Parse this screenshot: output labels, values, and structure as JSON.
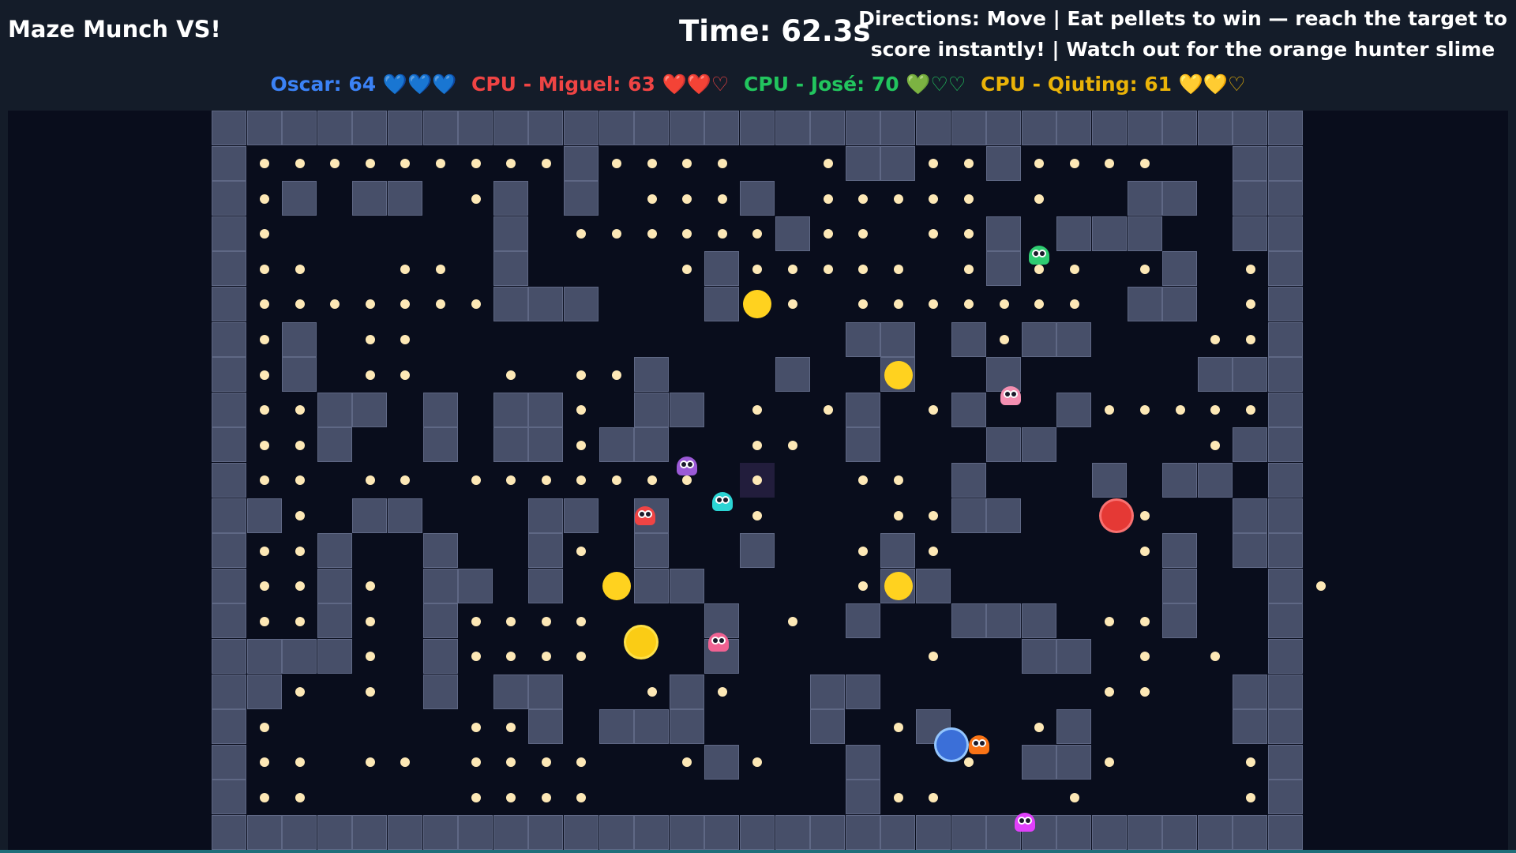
{
  "header": {
    "title": "Maze Munch VS!",
    "timer": "Time: 62.3s",
    "directions_line1": "Directions: Move | Eat pellets to win — reach the target to",
    "directions_line2": "score instantly! | Watch out for the orange hunter slime"
  },
  "scoreboard": [
    {
      "label": "Oscar: 64",
      "hearts": "💙💙💙",
      "color": "#3b82f6"
    },
    {
      "label": "CPU - Miguel: 63",
      "hearts": "❤️❤️♡",
      "color": "#ef4444"
    },
    {
      "label": "CPU - José: 70",
      "hearts": "💚♡♡",
      "color": "#22c55e"
    },
    {
      "label": "CPU - Qiuting: 61",
      "hearts": "💛💛♡",
      "color": "#eab308"
    }
  ],
  "maze": {
    "cols": 31,
    "rows": 21,
    "rows_map": [
      "###############################",
      "#.........#.......##..#......##",
      "#.#.##..#.#....#..........##.##",
      "#.......#.......#.....#.###..##",
      "#.......#.....#.......#....#..#",
      "#.......###...#...........##..#",
      "#.#...............##.#.##.....#",
      "#.#.........#...#..#..#.....###",
      "#..##.#.##..##....#..#..#.....#",
      "#..#..#.##.##.....#...##.....##",
      "#....................#...#.##.#",
      "##..##...##.#........##......##",
      "#..#..#..#..#..#...#.......#.##",
      "#..#..##.#..##.....##......#..#",
      "#..#..#.......#...#..###...#..#",
      "####..#.......#........##.....#",
      "##....#.##...#...##..........##",
      "#........#.###...#..#...#....##",
      "#.............#...#....##.....#",
      "#.................#...........#",
      "###############################"
    ],
    "pellet_rows": [
      "...............................",
      ".ooooooooo.oooo..oo.ooooooo....",
      ".o.....oo.o.oooo.ooooo.o..oo.o.",
      ".o........oooooo.oo.ooo.......",
      ".oo..oo......ooooooo.oooo.o..oo",
      ".ooooooo.......oo.ooooooo....o.",
      ".o..oo............oo.oo.....ooo",
      ".o..oo..o.ooo...o.....o.....oo.",
      ".oo.....ooo.o..o.oo.oo...oooooo",
      ".oo......ooo...oo...........ooo",
      ".oo.oo.ooooooo.o..oo........o.o",
      "..o.......o.o..o...oo.....o..o.",
      ".oo.......o....o..ooo.....o..o.",
      ".oo.o..o.o..o.....o...........oo",
      ".oo.o..oooo.....o.o......oo...",
      "....o..oooo.........o.....o.o.o",
      "..o.o.o.o...o.o..........oo..o.",
      ".o.....ooo.........o...o.......",
      ".oo.oo.oooo..ooo.....o...o...oo",
      ".oo....oooo........oo...o....oo",
      "..............................."
    ],
    "power_pellets": [
      {
        "c": 15,
        "r": 5
      },
      {
        "c": 19,
        "r": 7
      },
      {
        "c": 11,
        "r": 13
      },
      {
        "c": 19,
        "r": 13
      }
    ],
    "target_tile": {
      "c": 15,
      "r": 10
    }
  },
  "slimes": [
    {
      "name": "green-slime",
      "color": "#2ecc71",
      "c": 23.5,
      "r": 4.1
    },
    {
      "name": "pink-slime",
      "color": "#f48fb1",
      "c": 22.7,
      "r": 8.1
    },
    {
      "name": "purple-slime",
      "color": "#9b59d6",
      "c": 13.5,
      "r": 10.1
    },
    {
      "name": "cyan-slime",
      "color": "#2bd4d4",
      "c": 14.5,
      "r": 11.1
    },
    {
      "name": "red-slime",
      "color": "#ef4444",
      "c": 12.3,
      "r": 11.5
    },
    {
      "name": "pink-slime",
      "color": "#f06292",
      "c": 14.4,
      "r": 15.1
    },
    {
      "name": "orange-hunter-slime",
      "color": "#f97316",
      "c": 21.8,
      "r": 18.0
    },
    {
      "name": "magenta-slime",
      "color": "#e040fb",
      "c": 23.1,
      "r": 20.2
    }
  ],
  "players": [
    {
      "name": "cpu-miguel-marker",
      "color": "#e53935",
      "ring": "#f87171",
      "c": 25.7,
      "r": 11.5
    },
    {
      "name": "cpu-qiuting-marker",
      "color": "#facc15",
      "ring": "#fde047",
      "c": 12.2,
      "r": 15.1
    },
    {
      "name": "oscar-player-marker",
      "color": "#3b6fd8",
      "ring": "#93c5fd",
      "c": 21.0,
      "r": 18.0
    }
  ]
}
